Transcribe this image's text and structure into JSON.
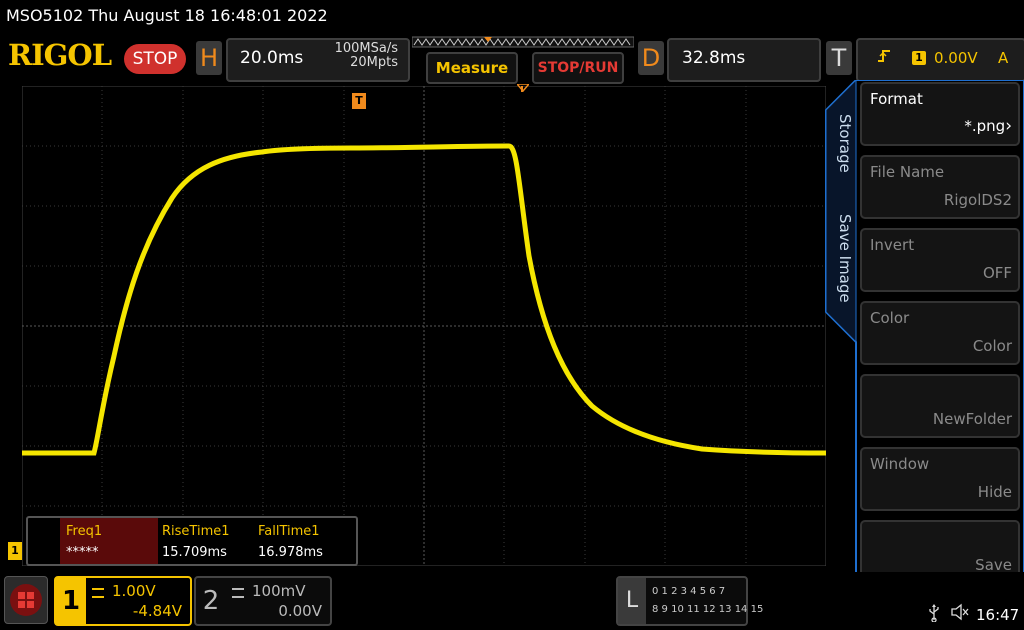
{
  "title_bar": {
    "text": "MSO5102  Thu August 18 16:48:01 2022"
  },
  "top_bar": {
    "logo": "RIGOL",
    "run_state": "STOP",
    "horizontal": {
      "letter": "H",
      "timebase": "20.0ms",
      "sample_rate": "100MSa/s",
      "memory_depth": "20Mpts"
    },
    "measure_label": "Measure",
    "stop_run_label": "STOP/RUN",
    "delay": {
      "letter": "D",
      "value": "32.8ms"
    },
    "trigger": {
      "letter": "T",
      "source": "1",
      "level": "0.00V",
      "mode": "A"
    }
  },
  "side_tabs": {
    "storage": "Storage",
    "save_image": "Save Image"
  },
  "side_menu": [
    {
      "label": "Format",
      "value": "*.png",
      "enabled": true
    },
    {
      "label": "File Name",
      "value": "RigolDS2",
      "enabled": false
    },
    {
      "label": "Invert",
      "value": "OFF",
      "enabled": false
    },
    {
      "label": "Color",
      "value": "Color",
      "enabled": false
    },
    {
      "label": "",
      "value": "NewFolder",
      "enabled": false
    },
    {
      "label": "Window",
      "value": "Hide",
      "enabled": false
    },
    {
      "label": "",
      "value": "Save",
      "enabled": false
    }
  ],
  "measurements": [
    {
      "name": "Freq1",
      "value": "*****"
    },
    {
      "name": "RiseTime1",
      "value": "15.709ms"
    },
    {
      "name": "FallTime1",
      "value": "16.978ms"
    }
  ],
  "channel1": {
    "number": "1",
    "scale": "1.00V",
    "offset": "-4.84V",
    "marker": "1"
  },
  "channel2": {
    "number": "2",
    "scale": "100mV",
    "offset": "0.00V"
  },
  "logic_analyzer": {
    "letter": "L",
    "row1": "0 1 2 3  4 5 6 7",
    "row2": "8 9 10 11 12 13 14 15"
  },
  "status": {
    "usb_icon": "usb-icon",
    "speaker_icon": "speaker-muted-icon",
    "time": "16:47"
  },
  "trigger_marker": "T",
  "colors": {
    "ch1": "#f5c400",
    "accent_orange": "#f08a1c",
    "stop_red": "#d0312d",
    "panel_blue": "#1e6fd0"
  }
}
